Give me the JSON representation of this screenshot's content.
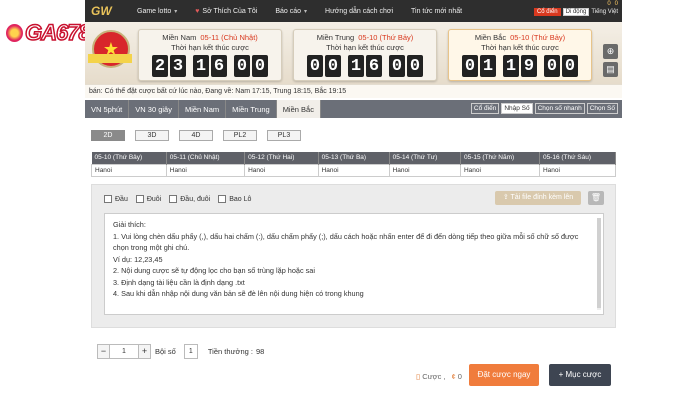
{
  "brand": {
    "logo_text": "GA6789"
  },
  "topnav": {
    "logo": "GW",
    "items": [
      {
        "label": "Game lotto",
        "has_chevron": true
      },
      {
        "label": "Sở Thích Của Tôi",
        "has_chevron": false
      },
      {
        "label": "Báo cáo",
        "has_chevron": true
      },
      {
        "label": "Hướng dẫn cách chơi",
        "has_chevron": false
      },
      {
        "label": "Tin tức mới nhất",
        "has_chevron": false
      }
    ],
    "right": {
      "count_a": "0",
      "count_b": "0",
      "classic_label": "Cổ điển",
      "classic_label_2": "Di động",
      "lang_label": "Tiếng Việt"
    }
  },
  "regions": [
    {
      "name": "Miền Nam",
      "date": "05-11 (Chủ Nhật)",
      "subtitle": "Thời hạn kết thúc cược",
      "digits": [
        "2",
        "3",
        "1",
        "6",
        "0",
        "0"
      ],
      "active": false
    },
    {
      "name": "Miền Trung",
      "date": "05-10 (Thứ Bảy)",
      "subtitle": "Thời hạn kết thúc cược",
      "digits": [
        "0",
        "0",
        "1",
        "6",
        "0",
        "0"
      ],
      "active": false
    },
    {
      "name": "Miền Bắc",
      "date": "05-10 (Thứ Bảy)",
      "subtitle": "Thời hạn kết thúc cược",
      "digits": [
        "0",
        "1",
        "1",
        "9",
        "0",
        "0"
      ],
      "active": true
    }
  ],
  "infobar": {
    "text": "bán: Có thể đặt cược bất cứ lúc nào,     Đang về: Nam 17:15, Trung 18:15, Bắc 19:15"
  },
  "game_tabs": [
    {
      "label": "VN 5phút",
      "active": false
    },
    {
      "label": "VN 30 giây",
      "active": false
    },
    {
      "label": "Miền Nam",
      "active": false
    },
    {
      "label": "Miền Trung",
      "active": false
    },
    {
      "label": "Miền Bắc",
      "active": true
    }
  ],
  "mode_buttons": [
    {
      "label": "Cổ điển",
      "active": false
    },
    {
      "label": "Nhập Số",
      "active": true
    },
    {
      "label": "Chọn số nhanh",
      "active": false
    },
    {
      "label": "Chọn Số",
      "active": false
    }
  ],
  "sub_tabs": [
    {
      "label": "2D",
      "active": true
    },
    {
      "label": "3D",
      "active": false
    },
    {
      "label": "4D",
      "active": false
    },
    {
      "label": "PL2",
      "active": false
    },
    {
      "label": "PL3",
      "active": false
    }
  ],
  "date_table": {
    "headers": [
      "05-10 (Thứ Bảy)",
      "05-11 (Chủ Nhật)",
      "05-12 (Thứ Hai)",
      "05-13 (Thứ Ba)",
      "05-14 (Thứ Tư)",
      "05-15 (Thứ Năm)",
      "05-16 (Thứ Sáu)"
    ],
    "row": [
      "Hanoi",
      "Hanoi",
      "Hanoi",
      "Hanoi",
      "Hanoi",
      "Hanoi",
      "Hanoi"
    ]
  },
  "checkboxes": [
    {
      "label": "Đầu",
      "checked": false
    },
    {
      "label": "Đuôi",
      "checked": false
    },
    {
      "label": "Đầu, đuôi",
      "checked": false
    },
    {
      "label": "Bao Lô",
      "checked": false
    }
  ],
  "upload_label": "Tải file đính kèm lên",
  "instructions": {
    "title": "Giải thích:",
    "lines": [
      "1. Vui lòng chèn dấu phẩy (,), dấu hai chấm (:), dấu chấm phẩy (;), dấu cách hoặc nhấn enter để đi đến dòng tiếp theo giữa mỗi số chữ số được chọn trong một ghi chú.",
      "Ví dụ: 12,23,45",
      "2. Nội dung cược sẽ tự động lọc cho bạn số trùng lặp hoặc sai",
      "3. Định dạng tài liệu cần là định dạng .txt",
      "4. Sau khi dẫn nhập nội dung văn bản sẽ đè lên nội dung hiện có trong khung"
    ]
  },
  "bottom": {
    "stepper_value": "1",
    "boi_label": "Bội số",
    "boi_value": "1",
    "tien_label": "Tiền thưởng :",
    "tien_value": "98",
    "bet_count_label": "Cược ,",
    "bet_amount": "0",
    "bet_button": "Đặt cược ngay",
    "list_button": "+ Mục cược"
  },
  "colors": {
    "accent_orange": "#f07c3c",
    "dark": "#3e4552",
    "red": "#d9391f"
  }
}
